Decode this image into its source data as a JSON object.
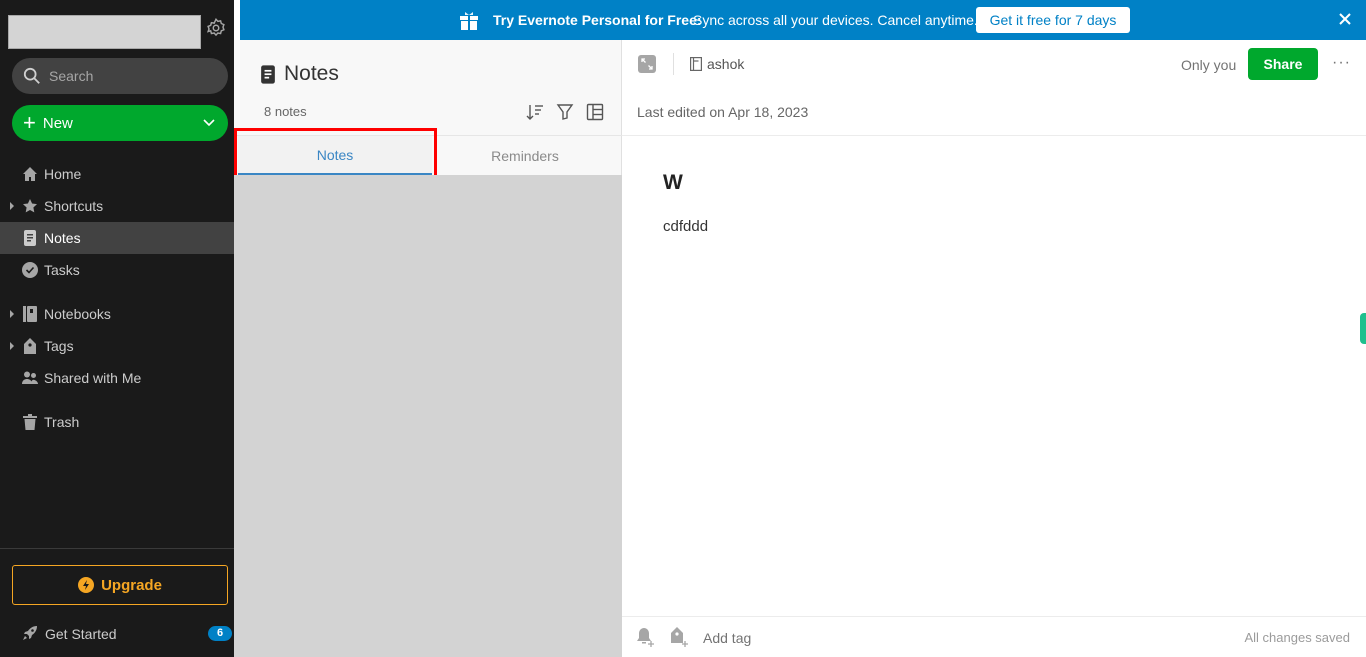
{
  "sidebar": {
    "search_placeholder": "Search",
    "new_label": "New",
    "items": [
      {
        "label": "Home",
        "icon": "home-icon",
        "expandable": false,
        "active": false
      },
      {
        "label": "Shortcuts",
        "icon": "star-icon",
        "expandable": true,
        "active": false
      },
      {
        "label": "Notes",
        "icon": "note-icon",
        "expandable": false,
        "active": true
      },
      {
        "label": "Tasks",
        "icon": "check-circle-icon",
        "expandable": false,
        "active": false
      },
      {
        "label": "Notebooks",
        "icon": "notebook-icon",
        "expandable": true,
        "active": false
      },
      {
        "label": "Tags",
        "icon": "tag-icon",
        "expandable": true,
        "active": false
      },
      {
        "label": "Shared with Me",
        "icon": "people-icon",
        "expandable": false,
        "active": false
      },
      {
        "label": "Trash",
        "icon": "trash-icon",
        "expandable": false,
        "active": false
      }
    ],
    "upgrade_label": "Upgrade",
    "get_started_label": "Get Started",
    "get_started_badge": "6"
  },
  "banner": {
    "bold_text": "Try Evernote Personal for Free:",
    "text": "Sync across all your devices. Cancel anytime.",
    "cta_label": "Get it free for 7 days"
  },
  "notes_list": {
    "title": "Notes",
    "count_label": "8 notes",
    "tabs": [
      {
        "label": "Notes",
        "active": true
      },
      {
        "label": "Reminders",
        "active": false
      }
    ]
  },
  "editor": {
    "notebook": "ashok",
    "visibility": "Only you",
    "share_label": "Share",
    "more_label": "···",
    "last_edited": "Last edited on Apr 18, 2023",
    "note_title": "W",
    "note_body": "cdfddd",
    "add_tag_label": "Add tag",
    "save_status": "All changes saved"
  },
  "colors": {
    "accent_green": "#00a82d",
    "banner_blue": "#0081c6",
    "upgrade_orange": "#f5a623",
    "highlight_red": "#ff0000"
  }
}
